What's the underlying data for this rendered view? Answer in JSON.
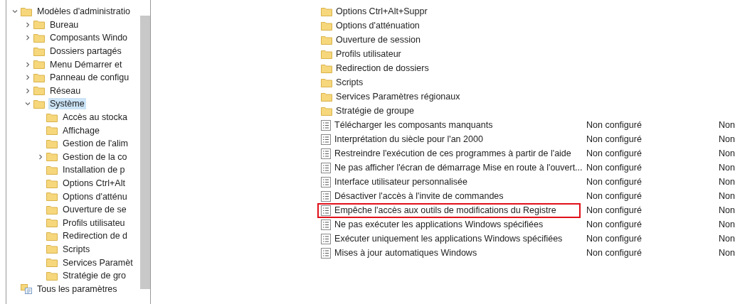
{
  "tree": [
    {
      "label": "Modèles d'administratio",
      "kind": "folder",
      "expanded": true,
      "selected": false,
      "children": [
        {
          "label": "Bureau",
          "kind": "folder",
          "expanded": false,
          "selected": false
        },
        {
          "label": "Composants Windo",
          "kind": "folder",
          "expanded": false,
          "selected": false
        },
        {
          "label": "Dossiers partagés",
          "kind": "folder",
          "selected": false
        },
        {
          "label": "Menu Démarrer et",
          "kind": "folder",
          "expanded": false,
          "selected": false
        },
        {
          "label": "Panneau de configu",
          "kind": "folder",
          "expanded": false,
          "selected": false
        },
        {
          "label": "Réseau",
          "kind": "folder",
          "expanded": false,
          "selected": false
        },
        {
          "label": "Système",
          "kind": "folder",
          "expanded": true,
          "selected": true,
          "children": [
            {
              "label": "Accès au stocka",
              "kind": "folder",
              "selected": false
            },
            {
              "label": "Affichage",
              "kind": "folder",
              "selected": false
            },
            {
              "label": "Gestion de l'alim",
              "kind": "folder",
              "selected": false
            },
            {
              "label": "Gestion de la co",
              "kind": "folder",
              "expanded": false,
              "selected": false
            },
            {
              "label": "Installation de p",
              "kind": "folder",
              "selected": false
            },
            {
              "label": "Options Ctrl+Alt",
              "kind": "folder",
              "selected": false
            },
            {
              "label": "Options d'atténu",
              "kind": "folder",
              "selected": false
            },
            {
              "label": "Ouverture de se",
              "kind": "folder",
              "selected": false
            },
            {
              "label": "Profils utilisateu",
              "kind": "folder",
              "selected": false
            },
            {
              "label": "Redirection de d",
              "kind": "folder",
              "selected": false
            },
            {
              "label": "Scripts",
              "kind": "folder",
              "selected": false
            },
            {
              "label": "Services Paramèt",
              "kind": "folder",
              "selected": false
            },
            {
              "label": "Stratégie de gro",
              "kind": "folder",
              "selected": false
            }
          ]
        }
      ]
    },
    {
      "label": "Tous les paramètres",
      "kind": "all-settings",
      "selected": false
    }
  ],
  "list": [
    {
      "kind": "folder",
      "name": "Options Ctrl+Alt+Suppr",
      "annotated": false
    },
    {
      "kind": "folder",
      "name": "Options d'atténuation",
      "annotated": false
    },
    {
      "kind": "folder",
      "name": "Ouverture de session",
      "annotated": false
    },
    {
      "kind": "folder",
      "name": "Profils utilisateur",
      "annotated": false
    },
    {
      "kind": "folder",
      "name": "Redirection de dossiers",
      "annotated": false
    },
    {
      "kind": "folder",
      "name": "Scripts",
      "annotated": false
    },
    {
      "kind": "folder",
      "name": "Services Paramètres régionaux",
      "annotated": false
    },
    {
      "kind": "folder",
      "name": "Stratégie de groupe",
      "annotated": false
    },
    {
      "kind": "setting",
      "name": "Télécharger les composants manquants",
      "state": "Non configuré",
      "column_3": "Non",
      "annotated": false
    },
    {
      "kind": "setting",
      "name": "Interprétation du siècle pour l'an 2000",
      "state": "Non configuré",
      "column_3": "Non",
      "annotated": false
    },
    {
      "kind": "setting",
      "name": "Restreindre l'exécution de ces programmes à partir de l'aide",
      "state": "Non configuré",
      "column_3": "Non",
      "annotated": false
    },
    {
      "kind": "setting",
      "name": "Ne pas afficher l'écran de démarrage Mise en route à l'ouvert...",
      "state": "Non configuré",
      "column_3": "Non",
      "annotated": false
    },
    {
      "kind": "setting",
      "name": "Interface utilisateur personnalisée",
      "state": "Non configuré",
      "column_3": "Non",
      "annotated": false
    },
    {
      "kind": "setting",
      "name": "Désactiver l'accès à l'invite de commandes",
      "state": "Non configuré",
      "column_3": "Non",
      "annotated": false
    },
    {
      "kind": "setting",
      "name": "Empêche l'accès aux outils de modifications du Registre",
      "state": "Non configuré",
      "column_3": "Non",
      "annotated": true
    },
    {
      "kind": "setting",
      "name": "Ne pas exécuter les applications Windows spécifiées",
      "state": "Non configuré",
      "column_3": "Non",
      "annotated": false
    },
    {
      "kind": "setting",
      "name": "Exécuter uniquement les applications Windows spécifiées",
      "state": "Non configuré",
      "column_3": "Non",
      "annotated": false
    },
    {
      "kind": "setting",
      "name": "Mises à jour automatiques Windows",
      "state": "Non configuré",
      "column_3": "Non",
      "annotated": false
    }
  ]
}
